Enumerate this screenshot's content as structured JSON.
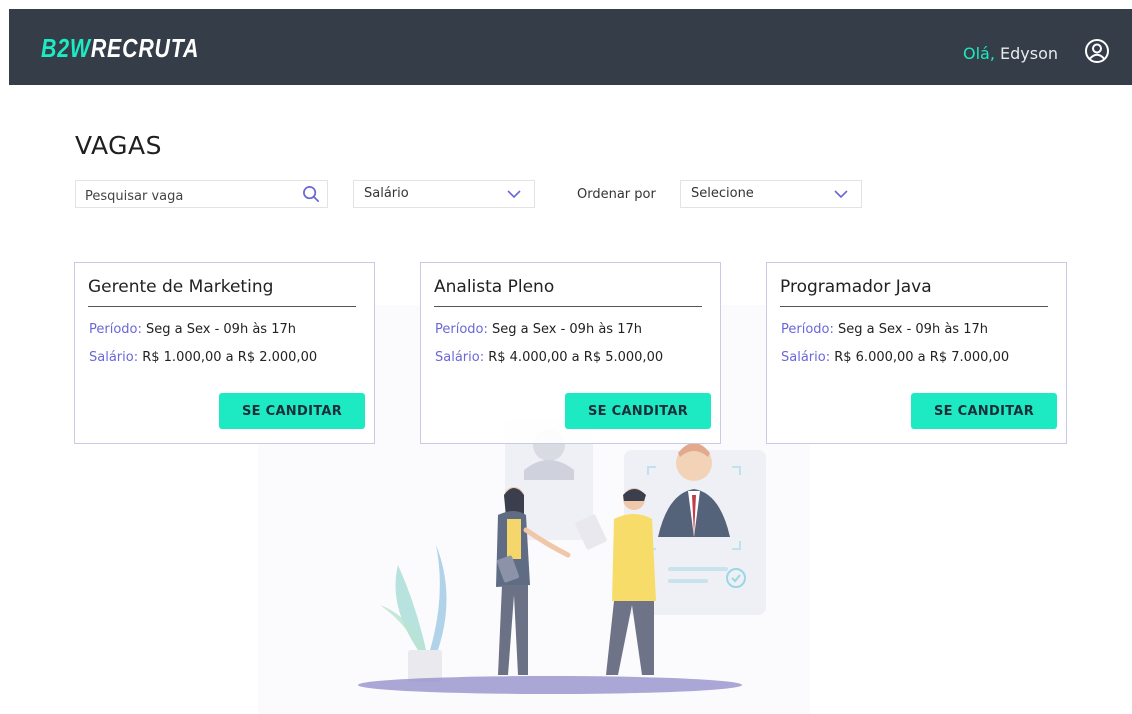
{
  "header": {
    "logo_part1": "B2W",
    "logo_part2": "RECRUTA",
    "greeting": "Olá,",
    "user_name": " Edyson",
    "user_icon": "user-circle-icon"
  },
  "page": {
    "title": "VAGAS"
  },
  "filters": {
    "search_placeholder": "Pesquisar vaga",
    "search_icon": "search-icon",
    "salary_select": "Salário",
    "order_label": "Ordenar por",
    "order_select": "Selecione"
  },
  "jobs": [
    {
      "title": "Gerente de Marketing",
      "period_label": "Período:",
      "period_value": " Seg a Sex - 09h às 17h",
      "salary_label": "Salário:",
      "salary_value": "  R$ 1.000,00 a R$ 2.000,00",
      "button": "SE CANDITAR"
    },
    {
      "title": "Analista Pleno",
      "period_label": "Período:",
      "period_value": " Seg a Sex - 09h às 17h",
      "salary_label": "Salário:",
      "salary_value": "  R$ 4.000,00 a R$ 5.000,00",
      "button": "SE CANDITAR"
    },
    {
      "title": "Programador Java",
      "period_label": "Período:",
      "period_value": " Seg a Sex - 09h às 17h",
      "salary_label": "Salário:",
      "salary_value": "  R$ 6.000,00 a R$ 7.000,00",
      "button": "SE CANDITAR"
    }
  ],
  "colors": {
    "header_bg": "#353e48",
    "accent": "#1de9c2",
    "label": "#6a67d8"
  }
}
